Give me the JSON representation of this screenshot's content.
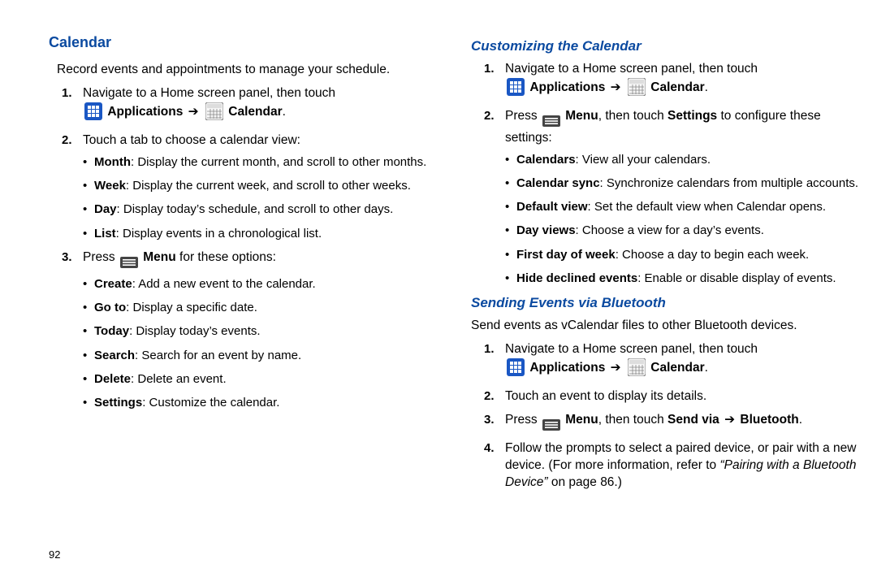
{
  "page_number": "92",
  "icons": {
    "applications": "apps-icon",
    "calendar": "calendar-icon",
    "menu": "menu-icon"
  },
  "labels": {
    "applications": "Applications",
    "calendar": "Calendar",
    "menu": "Menu",
    "arrow": "➔"
  },
  "left": {
    "heading": "Calendar",
    "intro": "Record events and appointments to manage your schedule.",
    "step1": "Navigate to a Home screen panel, then touch",
    "step2": "Touch a tab to choose a calendar view:",
    "views": [
      {
        "name": "Month",
        "desc": ": Display the current month, and scroll to other months."
      },
      {
        "name": "Week",
        "desc": ": Display the current week, and scroll to other weeks."
      },
      {
        "name": "Day",
        "desc": ": Display today’s schedule, and scroll to other days."
      },
      {
        "name": "List",
        "desc": ": Display events in a chronological list."
      }
    ],
    "step3_pre": "Press ",
    "step3_post": " for these options:",
    "options": [
      {
        "name": "Create",
        "desc": ": Add a new event to the calendar."
      },
      {
        "name": "Go to",
        "desc": ": Display a specific date."
      },
      {
        "name": "Today",
        "desc": ": Display today’s events."
      },
      {
        "name": "Search",
        "desc": ": Search for an event by name."
      },
      {
        "name": "Delete",
        "desc": ": Delete an event."
      },
      {
        "name": "Settings",
        "desc": ": Customize the calendar."
      }
    ]
  },
  "right1": {
    "heading": "Customizing the Calendar",
    "step1": "Navigate to a Home screen panel, then touch",
    "step2_pre": "Press ",
    "step2_mid": ", then touch ",
    "step2_settings": "Settings",
    "step2_post": " to configure these settings:",
    "settings": [
      {
        "name": "Calendars",
        "desc": ": View all your calendars."
      },
      {
        "name": "Calendar sync",
        "desc": ": Synchronize calendars from multiple accounts."
      },
      {
        "name": "Default view",
        "desc": ": Set the default view when Calendar opens."
      },
      {
        "name": "Day views",
        "desc": ": Choose a view for a day’s events."
      },
      {
        "name": "First day of week",
        "desc": ": Choose a day to begin each week."
      },
      {
        "name": "Hide declined events",
        "desc": ": Enable or disable display of events."
      }
    ]
  },
  "right2": {
    "heading": "Sending Events via Bluetooth",
    "intro": "Send events as vCalendar files to other Bluetooth devices.",
    "step1": "Navigate to a Home screen panel, then touch",
    "step2": "Touch an event to display its details.",
    "step3_pre": "Press ",
    "step3_mid": ", then touch ",
    "step3_sendvia": "Send via",
    "step3_bt": "Bluetooth",
    "step4_a": "Follow the prompts to select a paired device, or pair with a new device. (For more information, refer to ",
    "step4_ref": "“Pairing with a Bluetooth Device”",
    "step4_b": " on page 86.)"
  }
}
